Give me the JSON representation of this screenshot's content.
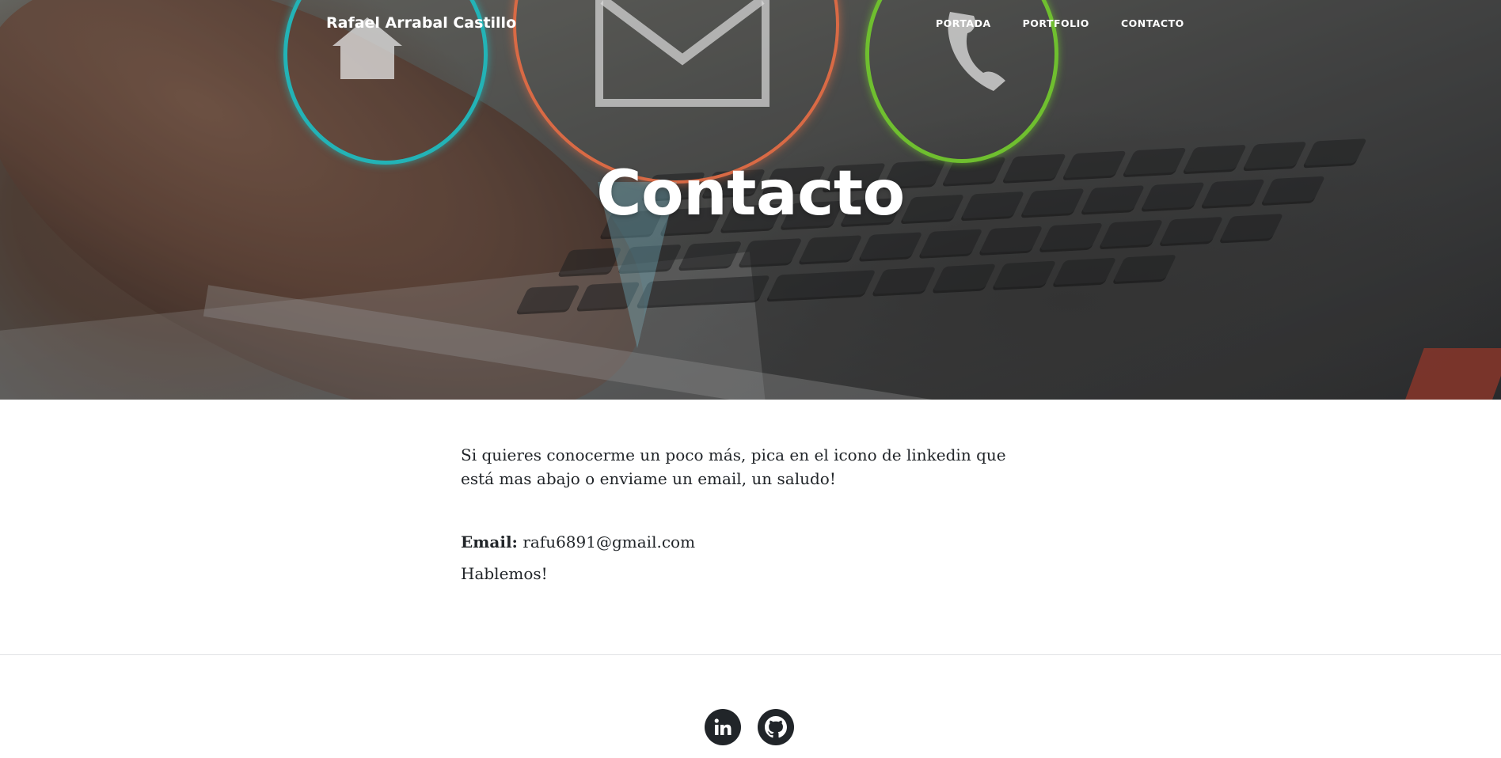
{
  "header": {
    "brand": "Rafael Arrabal Castillo",
    "nav": [
      "PORTADA",
      "PORTFOLIO",
      "CONTACTO"
    ]
  },
  "hero": {
    "title": "Contacto",
    "background_icons": [
      "home-icon",
      "mail-icon",
      "phone-icon"
    ]
  },
  "main": {
    "intro": "Si quieres conocerme un poco más, pica en el icono de linkedin que está mas abajo o enviame un email, un saludo!",
    "email_label": "Email:",
    "email_value": "rafu6891@gmail.com",
    "closing": "Hablemos!"
  },
  "footer": {
    "social_icons": [
      "linkedin-icon",
      "github-icon"
    ]
  },
  "colors": {
    "text": "#212529",
    "social_bg": "#212529",
    "ring_cyan": "#23b3b6",
    "ring_orange": "#d96a45",
    "ring_green": "#6fbf2f"
  }
}
